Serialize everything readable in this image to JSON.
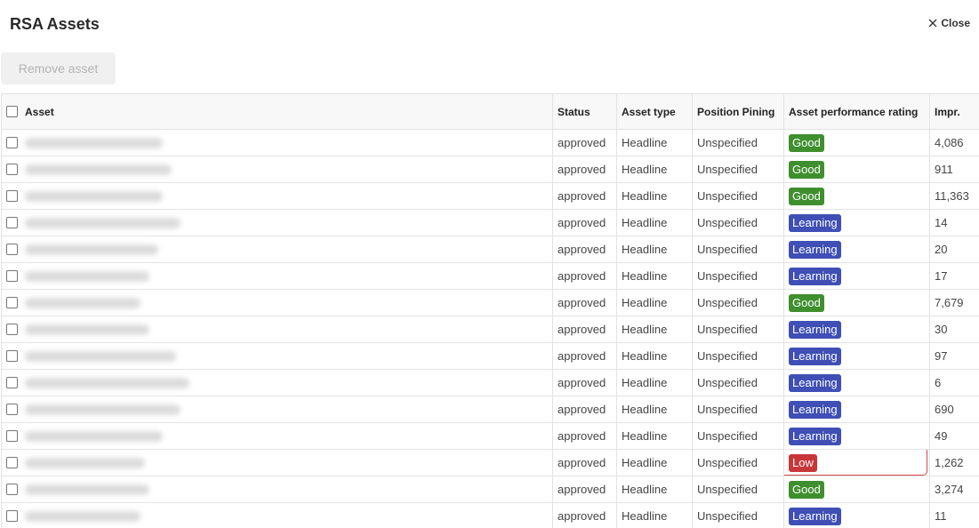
{
  "header": {
    "title": "RSA Assets",
    "close_label": "Close"
  },
  "toolbar": {
    "remove_label": "Remove asset"
  },
  "table": {
    "columns": {
      "asset": "Asset",
      "status": "Status",
      "type": "Asset type",
      "pinning": "Position Pining",
      "rating": "Asset performance rating",
      "impr": "Impr."
    },
    "rows": [
      {
        "status": "approved",
        "type": "Headline",
        "pinning": "Unspecified",
        "rating": "Good",
        "impr": "4,086"
      },
      {
        "status": "approved",
        "type": "Headline",
        "pinning": "Unspecified",
        "rating": "Good",
        "impr": "911"
      },
      {
        "status": "approved",
        "type": "Headline",
        "pinning": "Unspecified",
        "rating": "Good",
        "impr": "11,363"
      },
      {
        "status": "approved",
        "type": "Headline",
        "pinning": "Unspecified",
        "rating": "Learning",
        "impr": "14"
      },
      {
        "status": "approved",
        "type": "Headline",
        "pinning": "Unspecified",
        "rating": "Learning",
        "impr": "20"
      },
      {
        "status": "approved",
        "type": "Headline",
        "pinning": "Unspecified",
        "rating": "Learning",
        "impr": "17"
      },
      {
        "status": "approved",
        "type": "Headline",
        "pinning": "Unspecified",
        "rating": "Good",
        "impr": "7,679"
      },
      {
        "status": "approved",
        "type": "Headline",
        "pinning": "Unspecified",
        "rating": "Learning",
        "impr": "30"
      },
      {
        "status": "approved",
        "type": "Headline",
        "pinning": "Unspecified",
        "rating": "Learning",
        "impr": "97"
      },
      {
        "status": "approved",
        "type": "Headline",
        "pinning": "Unspecified",
        "rating": "Learning",
        "impr": "6"
      },
      {
        "status": "approved",
        "type": "Headline",
        "pinning": "Unspecified",
        "rating": "Learning",
        "impr": "690"
      },
      {
        "status": "approved",
        "type": "Headline",
        "pinning": "Unspecified",
        "rating": "Learning",
        "impr": "49"
      },
      {
        "status": "approved",
        "type": "Headline",
        "pinning": "Unspecified",
        "rating": "Low",
        "impr": "1,262",
        "highlighted": true
      },
      {
        "status": "approved",
        "type": "Headline",
        "pinning": "Unspecified",
        "rating": "Good",
        "impr": "3,274"
      },
      {
        "status": "approved",
        "type": "Headline",
        "pinning": "Unspecified",
        "rating": "Learning",
        "impr": "11"
      }
    ]
  },
  "colors": {
    "good": "#3f8f2f",
    "learning": "#3f4fb5",
    "low": "#c9363a",
    "highlight_border": "#d9464b"
  }
}
